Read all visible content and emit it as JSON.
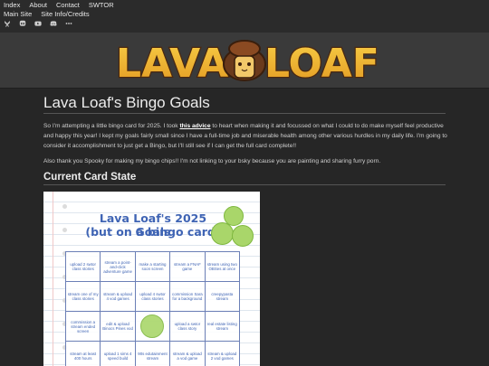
{
  "nav": {
    "row1": [
      "Index",
      "About",
      "Contact",
      "SWTOR"
    ],
    "row2": [
      "Main Site",
      "Site Info/Credits"
    ],
    "icons": [
      "bluesky-icon",
      "mastodon-icon",
      "youtube-icon",
      "discord-icon",
      "more-icon"
    ]
  },
  "banner": {
    "logo_text_left": "LAVA",
    "logo_text_right": "LOAF"
  },
  "page": {
    "title": "Lava Loaf's Bingo Goals",
    "para1_before": "So I'm attempting a little bingo card for 2025. I took ",
    "para1_link": "this advice",
    "para1_after": " to heart when making it and focussed on what I could to do make myself feel productive and happy this year! I kept my goals fairly small since I have a full-time job and miserable health among other various hurdles in my daily life. I'm going to consider it accomplishment to just get a Bingo, but I'll still see if I can get the full card complete!!",
    "para2": "Also thank you Spooky for making my bingo chips!! I'm not linking to your bsky because you are painting and sharing furry porn.",
    "section_title": "Current Card State"
  },
  "card": {
    "title_line1": "Lava Loaf's 2025 Goals",
    "title_line2": "(but on a bingo card)",
    "cells": [
      {
        "text": "upload 2 swtor class stories",
        "marked": false
      },
      {
        "text": "stream a point-and-click adventure game",
        "marked": false
      },
      {
        "text": "make a starting soon screen",
        "marked": false
      },
      {
        "text": "stream a FNAF game",
        "marked": false
      },
      {
        "text": "stream using two OBSes at once",
        "marked": false
      },
      {
        "text": "stream one of my class stories",
        "marked": false
      },
      {
        "text": "stream & upload 4 vod games",
        "marked": false
      },
      {
        "text": "upload 4 swtor class stories",
        "marked": false
      },
      {
        "text": "commission Sara for a background",
        "marked": false
      },
      {
        "text": "creepypasta stream",
        "marked": false
      },
      {
        "text": "commission a stream ended screen",
        "marked": false
      },
      {
        "text": "edit & upload Binocs Pines vod",
        "marked": false
      },
      {
        "text": "",
        "marked": true
      },
      {
        "text": "upload a swtor class story",
        "marked": false
      },
      {
        "text": "real estate listing stream",
        "marked": false
      },
      {
        "text": "stream at least 400 hours",
        "marked": false
      },
      {
        "text": "upload 1 sims 4 speed build",
        "marked": false
      },
      {
        "text": "90s edutainment stream",
        "marked": false
      },
      {
        "text": "stream & upload a vod game",
        "marked": false
      },
      {
        "text": "stream & upload 2 vod games",
        "marked": false
      }
    ]
  }
}
